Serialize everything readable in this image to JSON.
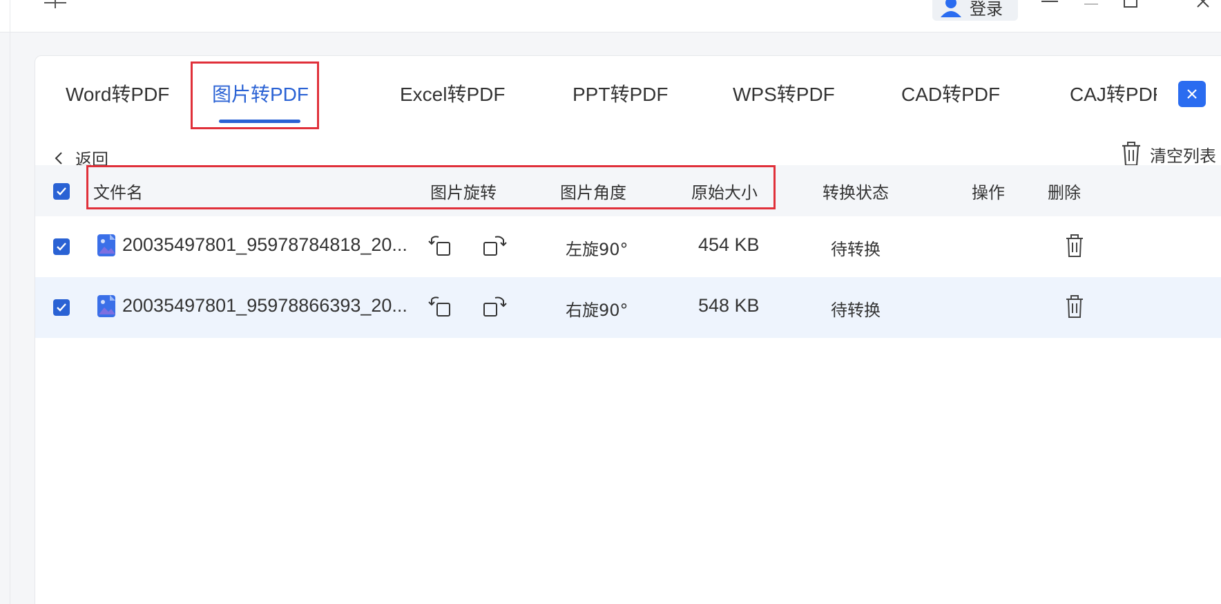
{
  "titlebar": {
    "login_label": "登录"
  },
  "tabs": [
    {
      "label": "Word转PDF"
    },
    {
      "label": "图片转PDF"
    },
    {
      "label": "Excel转PDF"
    },
    {
      "label": "PPT转PDF"
    },
    {
      "label": "WPS转PDF"
    },
    {
      "label": "CAD转PDF"
    },
    {
      "label": "CAJ转PDF"
    }
  ],
  "active_tab": "图片转PDF",
  "toolbar": {
    "back_label": "返回",
    "clear_label": "清空列表"
  },
  "table": {
    "headers": {
      "filename": "文件名",
      "rotate": "图片旋转",
      "angle": "图片角度",
      "size": "原始大小",
      "status": "转换状态",
      "action": "操作",
      "delete": "删除"
    },
    "rows": [
      {
        "filename": "20035497801_95978784818_20...",
        "angle": "左旋90°",
        "size": "454 KB",
        "status": "待转换"
      },
      {
        "filename": "20035497801_95978866393_20...",
        "angle": "右旋90°",
        "size": "548 KB",
        "status": "待转换"
      }
    ]
  },
  "colors": {
    "accent": "#2a62d4",
    "highlight": "#e0303a",
    "selected_row": "#eef4fd"
  }
}
